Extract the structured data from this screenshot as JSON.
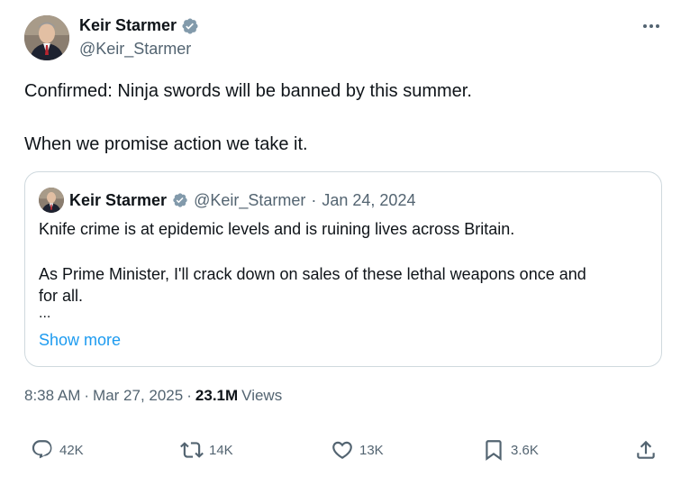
{
  "author": {
    "name": "Keir Starmer",
    "handle": "@Keir_Starmer"
  },
  "tweet": {
    "line1": "Confirmed: Ninja swords will be banned by this summer.",
    "line2": "When we promise action we take it."
  },
  "quoted_tweet": {
    "name": "Keir Starmer",
    "handle": "@Keir_Starmer",
    "separator": "·",
    "date": "Jan 24, 2024",
    "line1": "Knife crime is at epidemic levels and is ruining lives across Britain.",
    "line2": "As Prime Minister, I'll crack down on sales of these lethal weapons once and",
    "line3": "for all.",
    "ellipsis": "...",
    "show_more": "Show more"
  },
  "meta": {
    "time": "8:38 AM",
    "sep1": "·",
    "date": "Mar 27, 2025",
    "sep2": "·",
    "views_count": "23.1M",
    "views_label": "Views"
  },
  "actions": {
    "replies": "42K",
    "reposts": "14K",
    "likes": "13K",
    "bookmarks": "3.6K"
  },
  "colors": {
    "text": "#0f1419",
    "secondary": "#536471",
    "link": "#1d9bf0",
    "verified": "#829aab",
    "border": "#cfd9de"
  },
  "icons": {
    "verified": "verified-badge-icon",
    "more": "more-icon",
    "reply": "reply-icon",
    "repost": "repost-icon",
    "like": "heart-icon",
    "bookmark": "bookmark-icon",
    "share": "share-icon"
  }
}
